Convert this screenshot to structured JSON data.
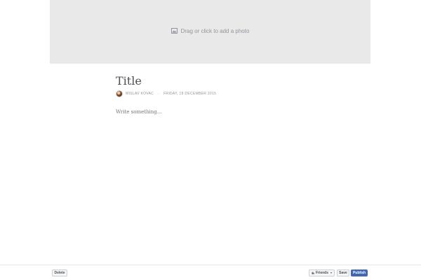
{
  "cover": {
    "label": "Drag or click to add a photo",
    "icon": "photo-icon"
  },
  "note": {
    "title": "Title",
    "author": "MISLAV KOVAC",
    "date": "FRIDAY, 18 DECEMBER 2015",
    "body_placeholder": "Write something..."
  },
  "footer": {
    "delete_label": "Delete",
    "audience_label": "Friends",
    "audience_icon": "friends-icon",
    "save_label": "Save",
    "publish_label": "Publish"
  },
  "colors": {
    "cover_bg": "#e9e9e9",
    "publish_bg": "#4267b2",
    "muted_text": "#90949c"
  }
}
